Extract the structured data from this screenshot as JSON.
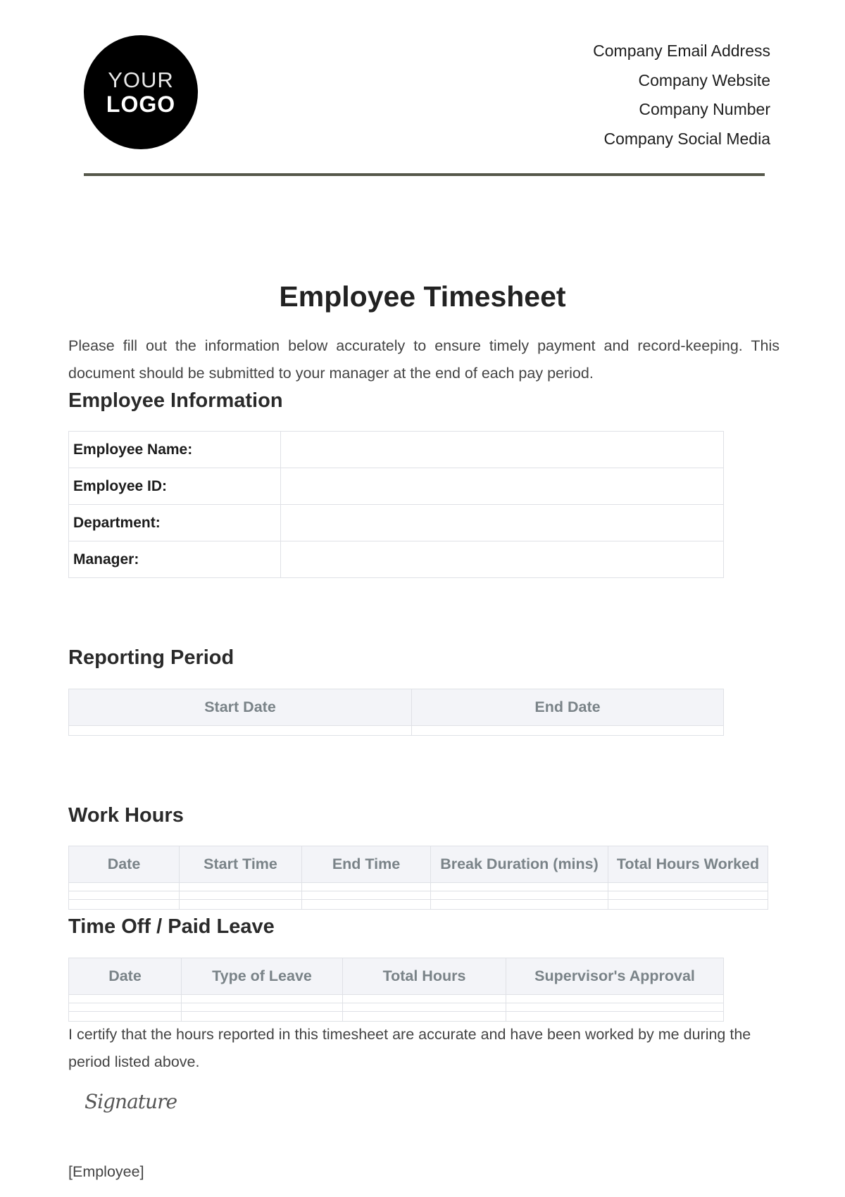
{
  "header": {
    "logo": {
      "line1": "YOUR",
      "line2": "LOGO"
    },
    "contact": [
      "Company Email Address",
      "Company Website",
      "Company Number",
      "Company Social Media"
    ],
    "divider_color": "#55574a"
  },
  "document": {
    "title": "Employee Timesheet",
    "intro": "Please fill out the information below accurately to ensure timely payment and record-keeping. This document should be submitted to your manager at the end of each pay period."
  },
  "employee_info": {
    "heading": "Employee Information",
    "rows": [
      {
        "label": "Employee Name:",
        "value": ""
      },
      {
        "label": "Employee ID:",
        "value": ""
      },
      {
        "label": "Department:",
        "value": ""
      },
      {
        "label": "Manager:",
        "value": ""
      }
    ]
  },
  "reporting_period": {
    "heading": "Reporting Period",
    "columns": [
      "Start Date",
      "End Date"
    ],
    "rows": [
      [
        "",
        ""
      ]
    ]
  },
  "work_hours": {
    "heading": "Work Hours",
    "columns": [
      "Date",
      "Start Time",
      "End Time",
      "Break Duration (mins)",
      "Total Hours Worked"
    ],
    "rows": [
      [
        "",
        "",
        "",
        "",
        ""
      ],
      [
        "",
        "",
        "",
        "",
        ""
      ],
      [
        "",
        "",
        "",
        "",
        ""
      ]
    ]
  },
  "time_off": {
    "heading": "Time Off / Paid Leave",
    "columns": [
      "Date",
      "Type of Leave",
      "Total Hours",
      "Supervisor's Approval"
    ],
    "rows": [
      [
        "",
        "",
        "",
        ""
      ],
      [
        "",
        "",
        "",
        ""
      ],
      [
        "",
        "",
        "",
        ""
      ]
    ]
  },
  "certification": {
    "text": "I certify that the hours reported in this timesheet are accurate and have been worked by me during the period listed above.",
    "signature": "Signature",
    "signer": "[Employee]"
  },
  "colors": {
    "header_bg": "#f3f4f8",
    "header_text": "#7a8388",
    "border": "#dfe1e6"
  }
}
